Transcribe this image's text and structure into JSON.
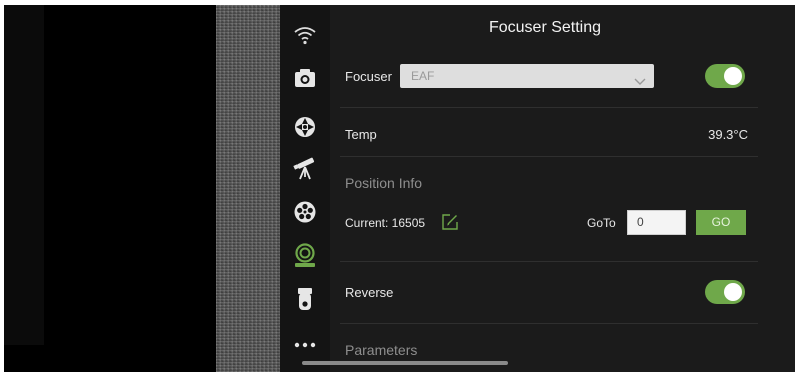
{
  "panel": {
    "title": "Focuser Setting",
    "focuser": {
      "label": "Focuser",
      "selected": "EAF",
      "enabled": true
    },
    "temp": {
      "label": "Temp",
      "value": "39.3°C"
    },
    "position_info": {
      "section_title": "Position Info",
      "current_text": "Current: 16505",
      "goto_label": "GoTo",
      "goto_value": "0",
      "go_button": "GO"
    },
    "reverse": {
      "label": "Reverse",
      "enabled": true
    },
    "parameters_title": "Parameters"
  },
  "sidebar": {
    "items": [
      {
        "icon": "wifi-icon"
      },
      {
        "icon": "camera-icon"
      },
      {
        "icon": "mount-icon"
      },
      {
        "icon": "telescope-icon"
      },
      {
        "icon": "filter-wheel-icon"
      },
      {
        "icon": "focuser-icon",
        "active": true
      },
      {
        "icon": "device-icon"
      },
      {
        "icon": "more-icon"
      }
    ]
  },
  "colors": {
    "accent": "#6fa84a",
    "panel_bg": "#1b1b1b",
    "sidebar_bg": "#141414"
  }
}
